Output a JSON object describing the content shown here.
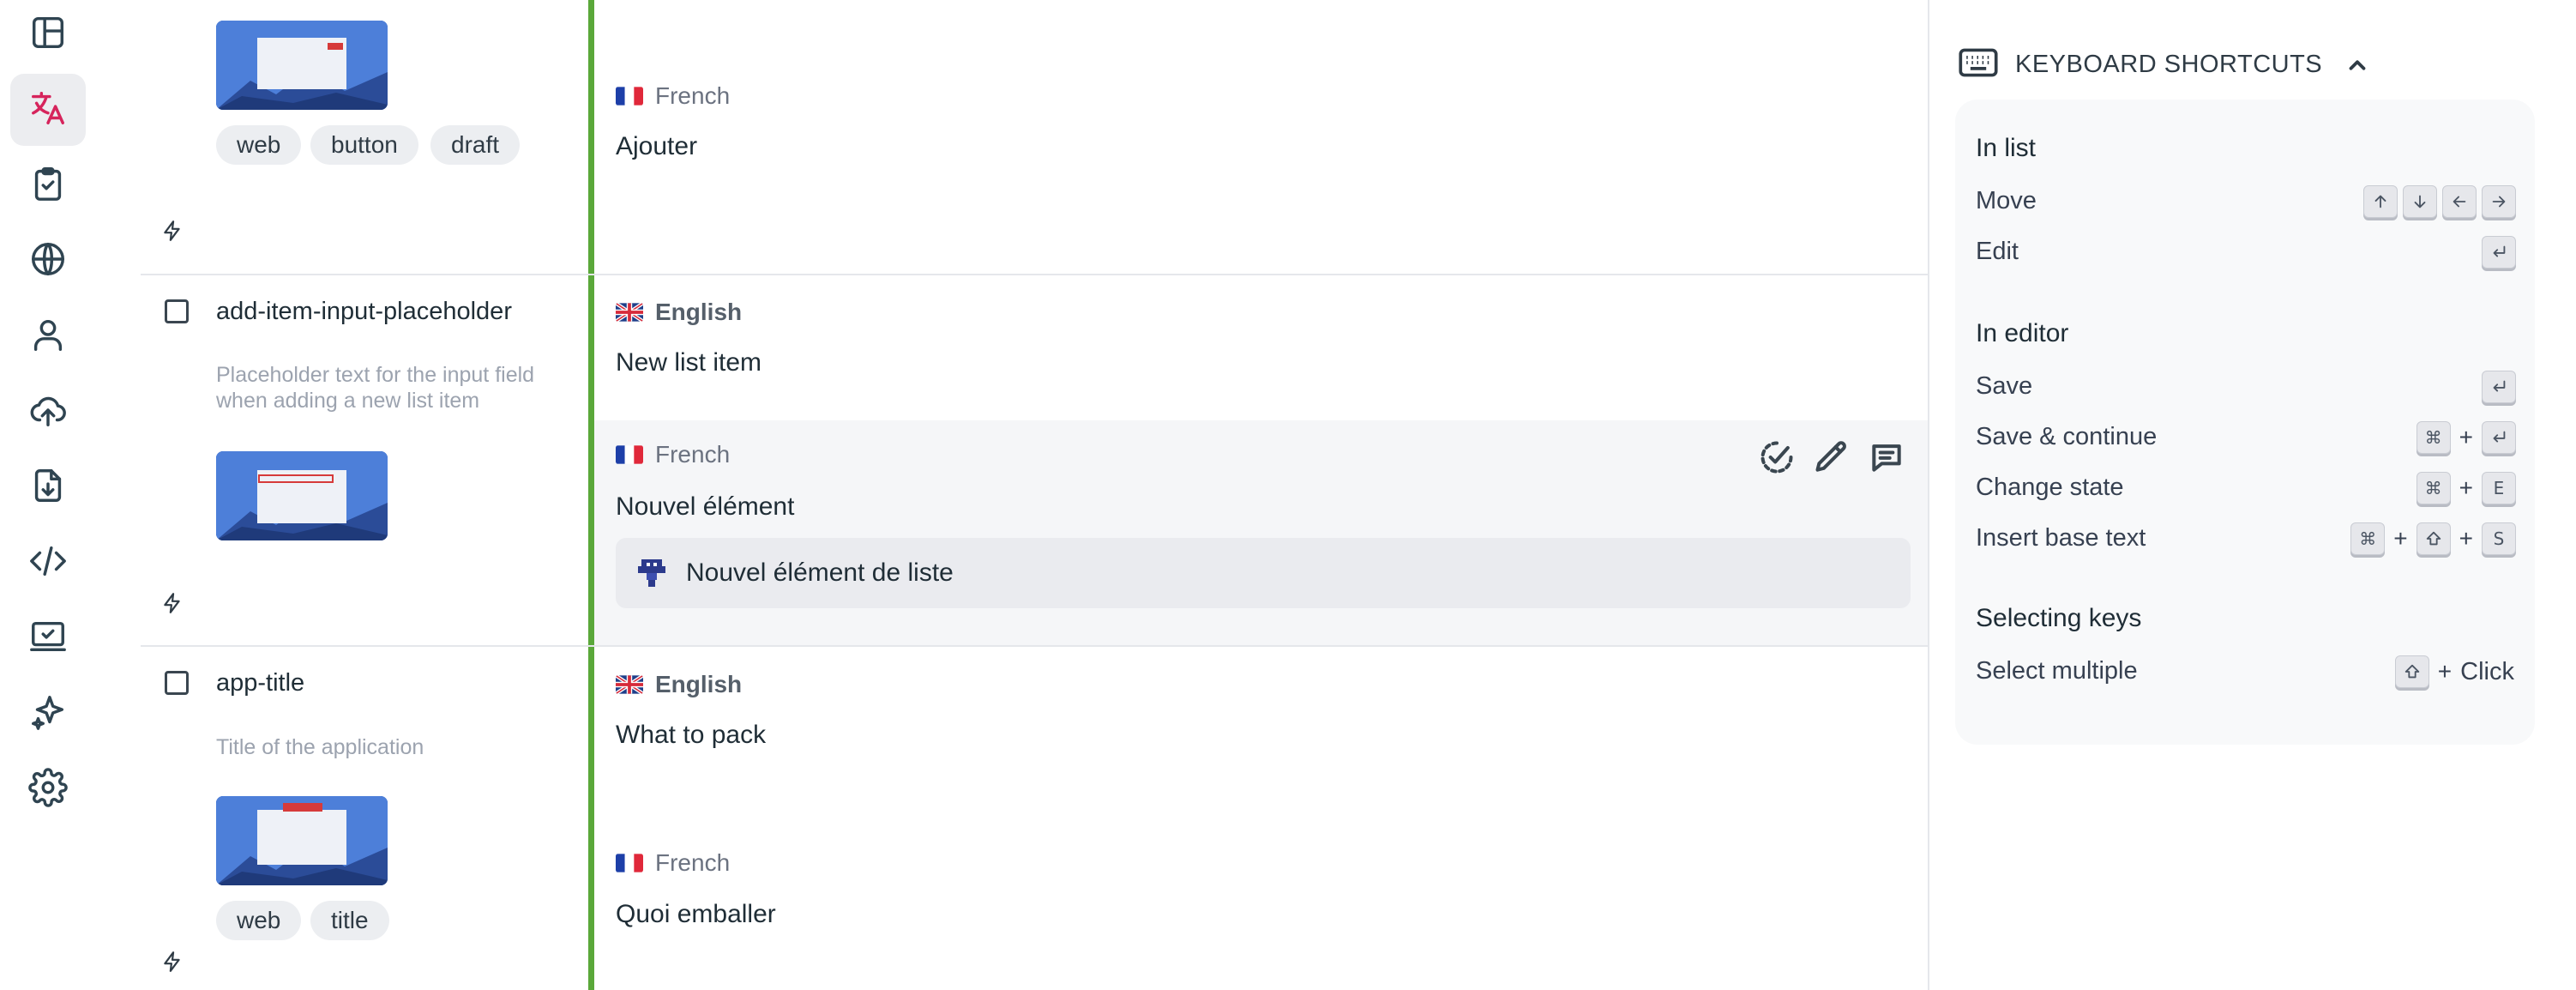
{
  "rail": {
    "items": [
      {
        "name": "dashboard-icon",
        "active": false
      },
      {
        "name": "translate-icon",
        "active": true
      },
      {
        "name": "tasks-icon",
        "active": false
      },
      {
        "name": "languages-icon",
        "active": false
      },
      {
        "name": "members-icon",
        "active": false
      },
      {
        "name": "import-icon",
        "active": false
      },
      {
        "name": "export-icon",
        "active": false
      },
      {
        "name": "developer-icon",
        "active": false
      },
      {
        "name": "integrate-icon",
        "active": false
      },
      {
        "name": "ai-icon",
        "active": false
      },
      {
        "name": "settings-icon",
        "active": false
      }
    ],
    "accent_color": "#d6245c"
  },
  "rows": [
    {
      "tags": [
        "web",
        "button",
        "draft"
      ],
      "translations": [
        {
          "language": "French",
          "value": "Ajouter"
        }
      ]
    },
    {
      "key": "add-item-input-placeholder",
      "description": "Placeholder text for the input field when adding a new list item",
      "translations": [
        {
          "language": "English",
          "value": "New list item"
        },
        {
          "language": "French",
          "value": "Nouvel élément"
        }
      ],
      "suggestion": "Nouvel élément de liste"
    },
    {
      "key": "app-title",
      "description": "Title of the application",
      "tags": [
        "web",
        "title"
      ],
      "translations": [
        {
          "language": "English",
          "value": "What to pack"
        },
        {
          "language": "French",
          "value": "Quoi emballer"
        }
      ]
    }
  ],
  "shortcuts": {
    "title": "KEYBOARD SHORTCUTS",
    "sections": [
      {
        "title": "In list",
        "items": [
          {
            "label": "Move"
          },
          {
            "label": "Edit"
          }
        ]
      },
      {
        "title": "In editor",
        "items": [
          {
            "label": "Save"
          },
          {
            "label": "Save & continue"
          },
          {
            "label": "Change state"
          },
          {
            "label": "Insert base text"
          }
        ]
      },
      {
        "title": "Selecting keys",
        "items": [
          {
            "label": "Select multiple",
            "suffix": "Click"
          }
        ]
      }
    ],
    "keys": {
      "cmd": "⌘",
      "e": "E",
      "s": "S",
      "plus": "+"
    }
  },
  "colors": {
    "state_bar": "#5aa83a",
    "thumb": "#4b7ed8"
  }
}
